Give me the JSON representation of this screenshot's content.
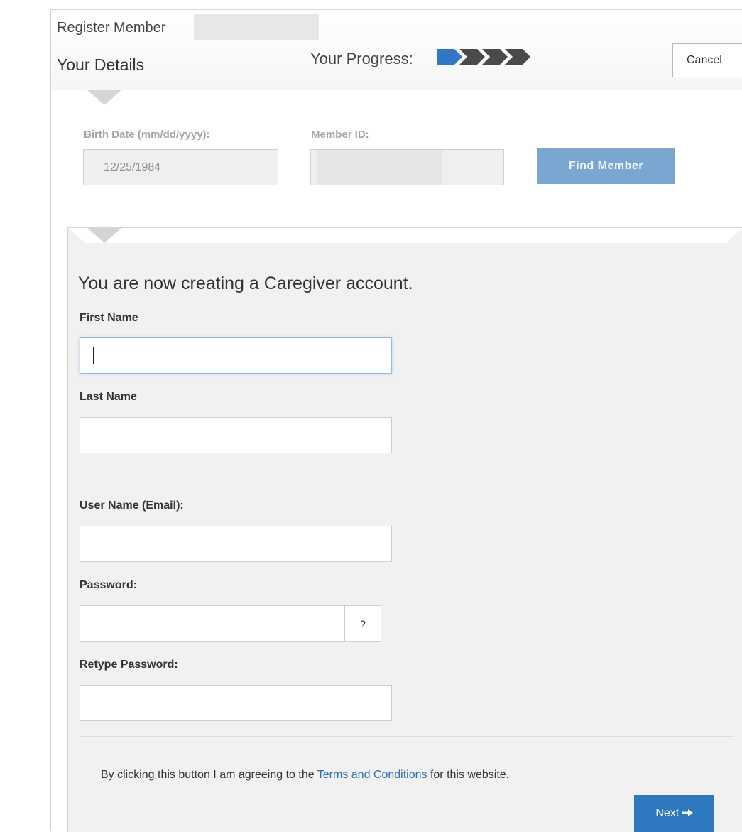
{
  "header": {
    "title": "Register Member",
    "subtitle": "Your Details",
    "progress_label": "Your Progress:",
    "progress": {
      "current_step": 1,
      "total_steps": 4,
      "active_color": "#2f77c9",
      "inactive_color": "#4a4a4a"
    },
    "cancel_label": "Cancel"
  },
  "lookup": {
    "birth_date_label": "Birth Date (mm/dd/yyyy):",
    "birth_date_value": "12/25/1984",
    "member_id_label": "Member ID:",
    "member_id_value": "",
    "find_label": "Find Member"
  },
  "form": {
    "heading": "You are now creating a Caregiver account.",
    "first_name_label": "First Name",
    "first_name_value": "",
    "last_name_label": "Last Name",
    "last_name_value": "",
    "username_label": "User Name (Email):",
    "username_value": "",
    "password_label": "Password:",
    "password_value": "",
    "password_help": "?",
    "retype_label": "Retype Password:",
    "retype_value": ""
  },
  "footer": {
    "terms_prefix": "By clicking this button I am agreeing to the ",
    "terms_link": "Terms and Conditions",
    "terms_suffix": " for this website.",
    "next_label": "Next",
    "next_icon": "arrow-right-icon"
  }
}
